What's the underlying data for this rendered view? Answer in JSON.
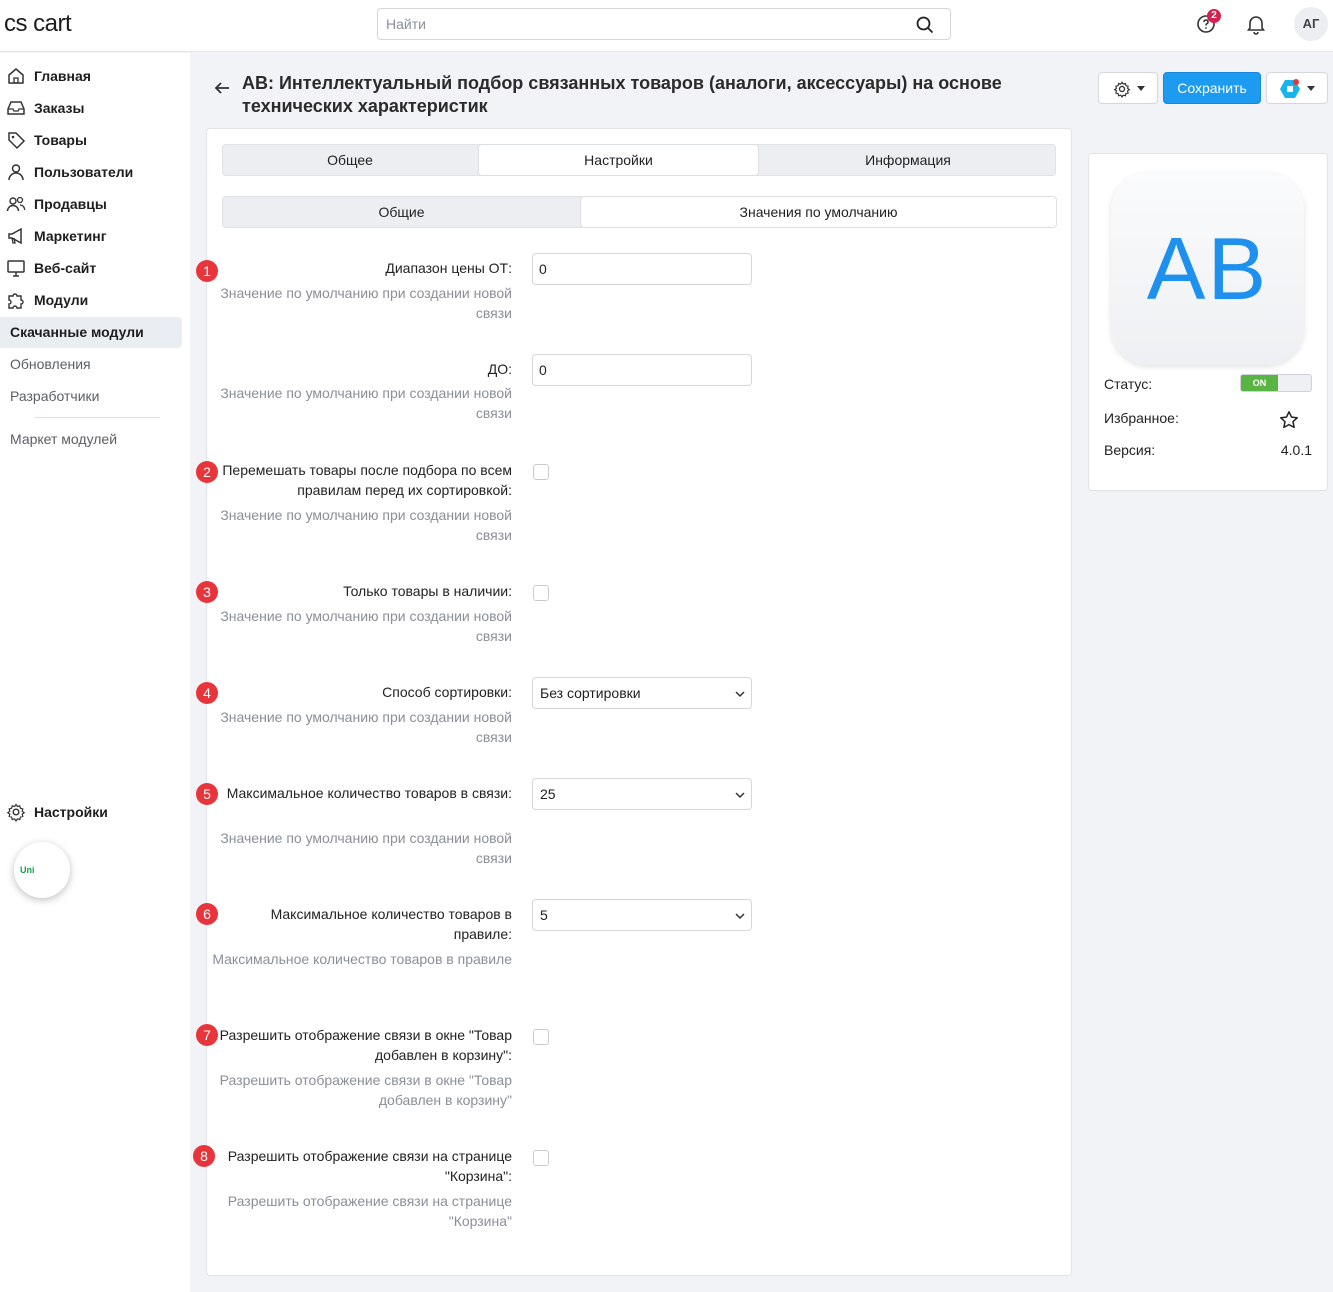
{
  "topbar": {
    "logo": "cs cart",
    "search_placeholder": "Найти",
    "notifications_badge": "2",
    "avatar_initials": "АГ"
  },
  "sidebar": {
    "items": [
      {
        "label": "Главная",
        "icon": "home-icon"
      },
      {
        "label": "Заказы",
        "icon": "inbox-icon"
      },
      {
        "label": "Товары",
        "icon": "tag-icon"
      },
      {
        "label": "Пользователи",
        "icon": "user-icon"
      },
      {
        "label": "Продавцы",
        "icon": "users-icon"
      },
      {
        "label": "Маркетинг",
        "icon": "megaphone-icon"
      },
      {
        "label": "Веб-сайт",
        "icon": "monitor-icon"
      },
      {
        "label": "Модули",
        "icon": "puzzle-icon"
      }
    ],
    "sub_items": [
      "Скачанные модули",
      "Обновления",
      "Разработчики",
      "Маркет модулей"
    ],
    "settings_label": "Настройки",
    "uni_label": "Uni"
  },
  "header": {
    "title": "АВ: Интеллектуальный подбор связанных товаров (аналоги, аксессуары) на основе технических характеристик",
    "save_label": "Сохранить"
  },
  "tabs": [
    "Общее",
    "Настройки",
    "Информация"
  ],
  "subtabs": [
    "Общие",
    "Значения по умолчанию"
  ],
  "settings": [
    {
      "num": "1",
      "label": "Диапазон цены ОТ:",
      "hint": "Значение по умолчанию при создании новой связи",
      "type": "text",
      "value": "0"
    },
    {
      "num": "",
      "label": "ДО:",
      "hint": "Значение по умолчанию при создании новой связи",
      "type": "text",
      "value": "0"
    },
    {
      "num": "2",
      "label": "Перемешать товары после подбора по всем правилам перед их сортировкой:",
      "hint": "Значение по умолчанию при создании новой связи",
      "type": "checkbox"
    },
    {
      "num": "3",
      "label": "Только товары в наличии:",
      "hint": "Значение по умолчанию при создании новой связи",
      "type": "checkbox"
    },
    {
      "num": "4",
      "label": "Способ сортировки:",
      "hint": "Значение по умолчанию при создании новой связи",
      "type": "select",
      "value": "Без сортировки"
    },
    {
      "num": "5",
      "label": "Максимальное количество товаров в связи:",
      "hint": "Значение по умолчанию при создании новой связи",
      "type": "select",
      "value": "25"
    },
    {
      "num": "6",
      "label": "Максимальное количество товаров в правиле:",
      "hint": "Максимальное количество товаров в правиле",
      "type": "select",
      "value": "5"
    },
    {
      "num": "7",
      "label": "Разрешить отображение связи в окне \"Товар добавлен в корзину\":",
      "hint": "Разрешить отображение связи в окне \"Товар добавлен в корзину\"",
      "type": "checkbox"
    },
    {
      "num": "8",
      "label": "Разрешить отображение связи на странице \"Корзина\":",
      "hint": "Разрешить отображение связи на странице \"Корзина\"",
      "type": "checkbox"
    }
  ],
  "info": {
    "app_initials": "AB",
    "status_label": "Статус:",
    "status_value": "ON",
    "favorite_label": "Избранное:",
    "version_label": "Версия:",
    "version_value": "4.0.1"
  },
  "colors": {
    "accent": "#1d9bf0",
    "marker": "#e8353b",
    "toggle_on": "#58b443"
  }
}
